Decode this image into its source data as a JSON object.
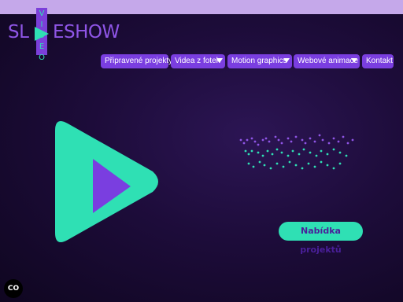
{
  "brand": {
    "name_part1": "SL",
    "name_part2": "ESHOW",
    "badge_text": "VIDEO",
    "text_color": "#8f55e6",
    "badge_color": "#7b3fd9",
    "accent_color": "#2fe0b4"
  },
  "nav": {
    "items": [
      {
        "label": "Připravené projekty",
        "has_dropdown": false
      },
      {
        "label": "Videa z fotek",
        "has_dropdown": true
      },
      {
        "label": "Motion graphics",
        "has_dropdown": true
      },
      {
        "label": "Webové animace",
        "has_dropdown": true
      },
      {
        "label": "Kontakt",
        "has_dropdown": false
      }
    ],
    "item_color": "#7a3ee0"
  },
  "hero": {
    "play_icon": "play-icon",
    "play_outer_color": "#2fe0b4",
    "play_inner_color": "#7a3ee0",
    "cta_label": "Nabídka projektů"
  },
  "cookie_button": {
    "label": "CO"
  },
  "colors": {
    "topbar": "#c5a8ea",
    "background": "#1d0c3a"
  }
}
